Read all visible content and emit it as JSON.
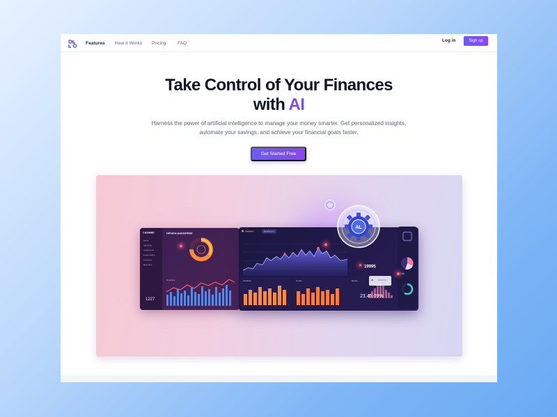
{
  "nav": {
    "links": [
      "Features",
      "How it Works",
      "Pricing",
      "FAQ"
    ],
    "active": "Features",
    "login_label": "Log in",
    "signup_label": "Sign up"
  },
  "hero": {
    "title_line1": "Take Control of Your Finances",
    "title_line2_prefix": "with",
    "title_line2_accent": "AI",
    "subtitle": "Harness the power of artificial intelligence to manage your money smarter. Get personalized insights, automate your savings, and achieve your financial goals faster.",
    "cta_label": "Get Started Free"
  },
  "colors": {
    "accent": "#7b4cf0",
    "button_start": "#6b5cf6",
    "button_end": "#8b45ee",
    "title": "#101427"
  },
  "mockup": {
    "left_panel": {
      "brand": "CASHMIE",
      "title": "DESIGN ANNIVERSE",
      "side_items": [
        "Home",
        "Spending",
        "Investments",
        "Travel Online",
        "Insurance",
        "Real Time"
      ],
      "chart_label": "Overview",
      "value": "1227"
    },
    "main_panel": {
      "header": "Sarturn",
      "tab": "Dashboard",
      "card_labels": [
        "Workflow",
        "Trends",
        "Market"
      ],
      "number": "19995",
      "pct": "23.45.09%",
      "badge_text": "AL"
    },
    "right_panel": {
      "number": "3.95"
    },
    "float_card_letter": "A"
  }
}
